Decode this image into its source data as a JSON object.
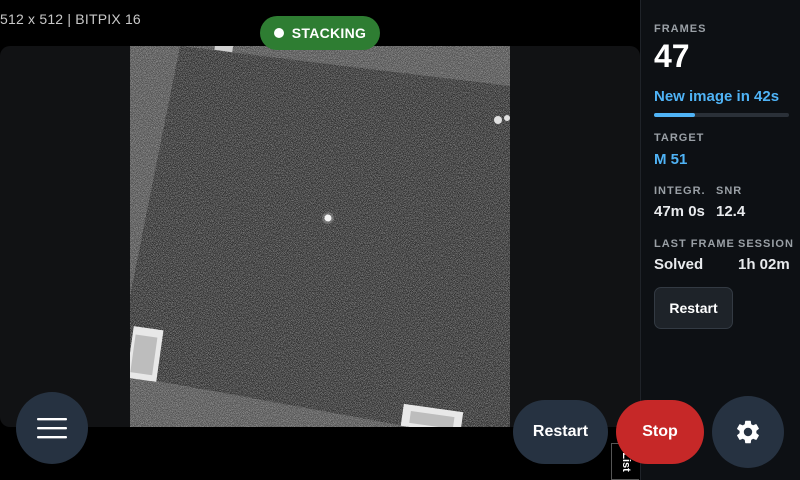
{
  "image_info": "512 x 512 | BITPIX 16",
  "status": {
    "label": "STACKING",
    "color": "#2e7d32"
  },
  "panel": {
    "frames_label": "FRAMES",
    "frames_value": "47",
    "new_image_text": "New image in 42s",
    "new_image_progress": 0.3,
    "target_label": "TARGET",
    "target_value": "M 51",
    "integration_label": "INTEGR.",
    "integration_value": "47m 0s",
    "snr_label": "SNR",
    "snr_value": "12.4",
    "last_frame_label": "LAST FRAME",
    "last_frame_value": "Solved",
    "session_label": "SESSION",
    "session_value": "1h 02m",
    "restart_label": "Restart"
  },
  "controls": {
    "restart_label": "Restart",
    "stop_label": "Stop",
    "list_tab_label": "List",
    "menu_icon": "hamburger-menu-icon",
    "settings_icon": "gear-icon"
  },
  "colors": {
    "accent": "#4fb3f6",
    "stop": "#c62828",
    "button": "#263241"
  }
}
